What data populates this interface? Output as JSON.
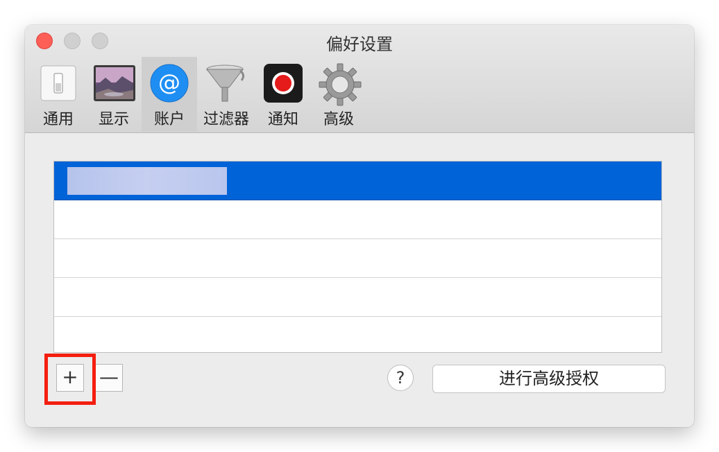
{
  "window": {
    "title": "偏好设置"
  },
  "toolbar": {
    "tabs": [
      {
        "label": "通用",
        "icon": "general-switch-icon"
      },
      {
        "label": "显示",
        "icon": "display-landscape-icon"
      },
      {
        "label": "账户",
        "icon": "at-sign-icon",
        "selected": true
      },
      {
        "label": "过滤器",
        "icon": "funnel-icon"
      },
      {
        "label": "通知",
        "icon": "record-notification-icon"
      },
      {
        "label": "高级",
        "icon": "gear-icon"
      }
    ]
  },
  "account_list": {
    "rows": 5,
    "selected_row": 0
  },
  "controls": {
    "add_label": "+",
    "remove_label": "—",
    "help_label": "?",
    "advanced_auth_label": "进行高级授权"
  },
  "colors": {
    "selection": "#0163d8",
    "highlight": "#f41e10",
    "close": "#fd5f57"
  }
}
